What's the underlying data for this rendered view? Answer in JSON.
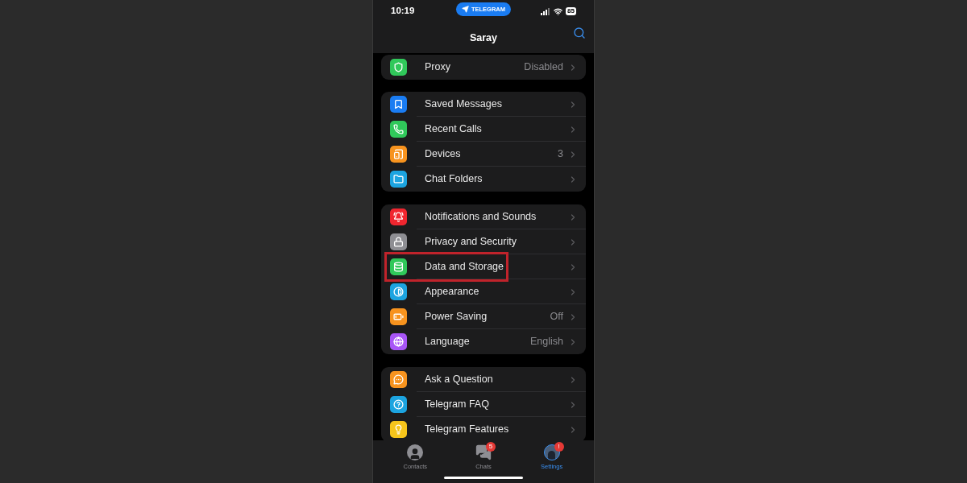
{
  "status_bar": {
    "time": "10:19",
    "app_pill": "TELEGRAM",
    "battery": "85"
  },
  "nav": {
    "title": "Saray"
  },
  "groups": [
    {
      "items": [
        {
          "label": "Proxy",
          "value": "Disabled",
          "color": "#30c85a",
          "highlighted": false
        }
      ]
    },
    {
      "items": [
        {
          "label": "Saved Messages",
          "color": "#1a7cf2",
          "highlighted": false
        },
        {
          "label": "Recent Calls",
          "color": "#30c85a",
          "highlighted": false
        },
        {
          "label": "Devices",
          "value": "3",
          "color": "#f7931e",
          "highlighted": false
        },
        {
          "label": "Chat Folders",
          "color": "#1ca4e0",
          "highlighted": false
        }
      ]
    },
    {
      "items": [
        {
          "label": "Notifications and Sounds",
          "color": "#f0262f",
          "highlighted": false
        },
        {
          "label": "Privacy and Security",
          "color": "#8e8e93",
          "highlighted": false
        },
        {
          "label": "Data and Storage",
          "color": "#30c85a",
          "highlighted": true
        },
        {
          "label": "Appearance",
          "color": "#1ca4e0",
          "highlighted": false
        },
        {
          "label": "Power Saving",
          "value": "Off",
          "color": "#f7931e",
          "highlighted": false
        },
        {
          "label": "Language",
          "value": "English",
          "color": "#a855f7",
          "highlighted": false
        }
      ]
    },
    {
      "items": [
        {
          "label": "Ask a Question",
          "color": "#f7931e",
          "highlighted": false
        },
        {
          "label": "Telegram FAQ",
          "color": "#1ca4e0",
          "highlighted": false
        },
        {
          "label": "Telegram Features",
          "color": "#f6c51b",
          "highlighted": false
        }
      ]
    }
  ],
  "tabs": [
    {
      "label": "Contacts",
      "kind": "contacts",
      "selected": false
    },
    {
      "label": "Chats",
      "kind": "chats",
      "badge": "5",
      "selected": false
    },
    {
      "label": "Settings",
      "kind": "avatar",
      "badge": "!",
      "selected": true
    }
  ]
}
